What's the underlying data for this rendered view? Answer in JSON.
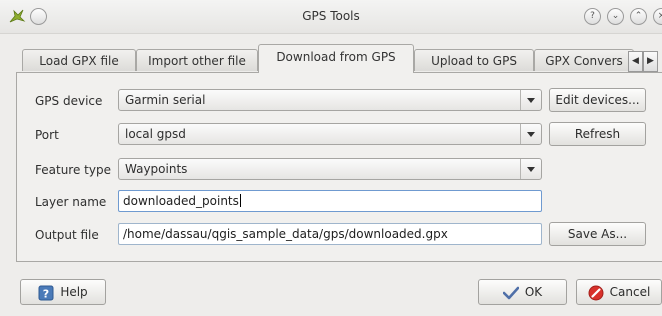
{
  "window": {
    "title": "GPS Tools"
  },
  "tabs": [
    {
      "label": "Load GPX file"
    },
    {
      "label": "Import other file"
    },
    {
      "label": "Download from GPS"
    },
    {
      "label": "Upload to GPS"
    },
    {
      "label": "GPX Convers"
    }
  ],
  "form": {
    "gps_device": {
      "label": "GPS device",
      "value": "Garmin serial"
    },
    "port": {
      "label": "Port",
      "value": "local gpsd"
    },
    "feature_type": {
      "label": "Feature type",
      "value": "Waypoints"
    },
    "layer_name": {
      "label": "Layer name",
      "value": "downloaded_points"
    },
    "output_file": {
      "label": "Output file",
      "value": "/home/dassau/qgis_sample_data/gps/downloaded.gpx"
    }
  },
  "buttons": {
    "edit_devices": "Edit devices...",
    "refresh": "Refresh",
    "save_as": "Save As...",
    "help": "Help",
    "ok": "OK",
    "cancel": "Cancel"
  },
  "colors": {
    "accent": "#4a7ab8",
    "cancel_icon": "#d8312b",
    "ok_icon": "#4f6fa8"
  }
}
